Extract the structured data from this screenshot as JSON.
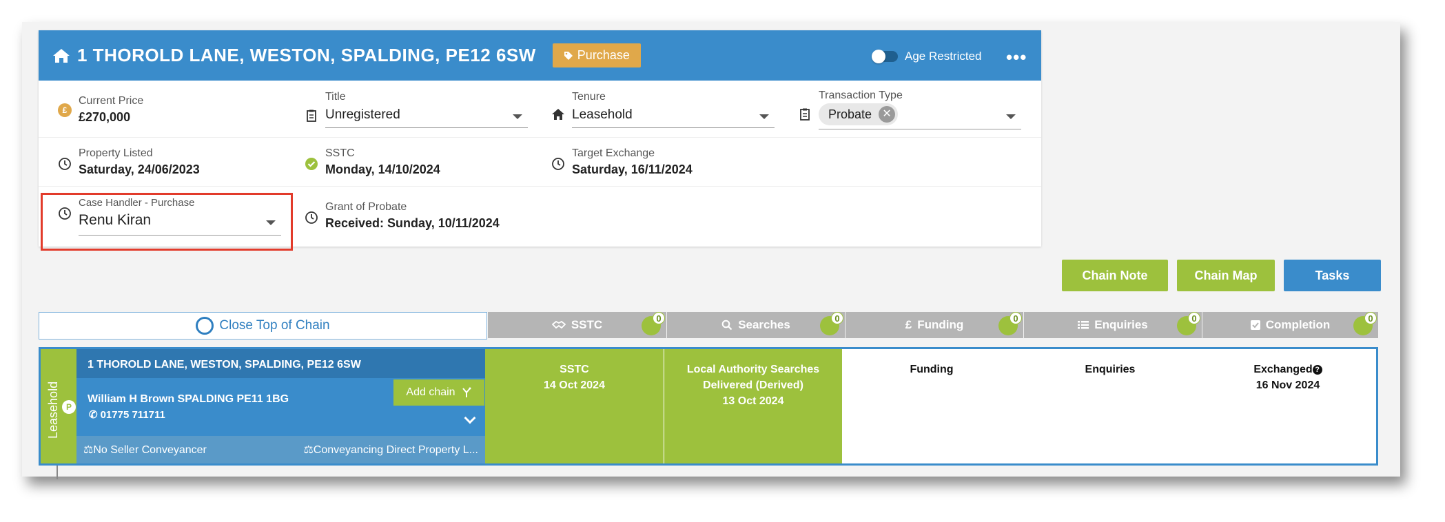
{
  "header": {
    "address": "1 THOROLD LANE, WESTON, SPALDING, PE12 6SW",
    "purchase_tag": "Purchase",
    "age_restricted_label": "Age Restricted",
    "more_label": "•••"
  },
  "fields": {
    "current_price_label": "Current Price",
    "current_price_value": "£270,000",
    "title_label": "Title",
    "title_value": "Unregistered",
    "tenure_label": "Tenure",
    "tenure_value": "Leasehold",
    "transaction_type_label": "Transaction Type",
    "transaction_type_chip": "Probate",
    "property_listed_label": "Property Listed",
    "property_listed_value": "Saturday, 24/06/2023",
    "sstc_label": "SSTC",
    "sstc_value": "Monday, 14/10/2024",
    "target_exchange_label": "Target Exchange",
    "target_exchange_value": "Saturday, 16/11/2024",
    "case_handler_label": "Case Handler - Purchase",
    "case_handler_value": "Renu Kiran",
    "grant_label": "Grant of Probate",
    "grant_value": "Received: Sunday, 10/11/2024"
  },
  "actions": {
    "chain_note": "Chain Note",
    "chain_map": "Chain Map",
    "tasks": "Tasks"
  },
  "chain_bar": {
    "close_top": "Close Top of Chain",
    "tabs": [
      {
        "label": "SSTC",
        "count": "0"
      },
      {
        "label": "Searches",
        "count": "0"
      },
      {
        "label": "Funding",
        "count": "0"
      },
      {
        "label": "Enquiries",
        "count": "0"
      },
      {
        "label": "Completion",
        "count": "0"
      }
    ]
  },
  "chain_row": {
    "tenure": "Leasehold",
    "p_badge": "P",
    "address": "1 THOROLD LANE, WESTON, SPALDING, PE12 6SW",
    "agent": "William H Brown SPALDING PE11 1BG",
    "phone": "01775 711711",
    "add_chain": "Add chain",
    "seller_conveyancer": "No Seller Conveyancer",
    "buyer_conveyancer": "Conveyancing Direct Property L...",
    "stages": [
      {
        "line1": "SSTC",
        "line2": "14 Oct 2024",
        "line3": ""
      },
      {
        "line1": "Local Authority Searches",
        "line2": "Delivered (Derived)",
        "line3": "13 Oct 2024"
      },
      {
        "line1": "Funding",
        "line2": "",
        "line3": ""
      },
      {
        "line1": "Enquiries",
        "line2": "",
        "line3": ""
      },
      {
        "line1": "Exchanged",
        "line2": "16 Nov 2024",
        "line3": ""
      }
    ]
  },
  "colors": {
    "header_blue": "#3a8ccb",
    "green": "#9dc13d",
    "tag_orange": "#e0a84a",
    "highlight_red": "#e23b2b"
  }
}
